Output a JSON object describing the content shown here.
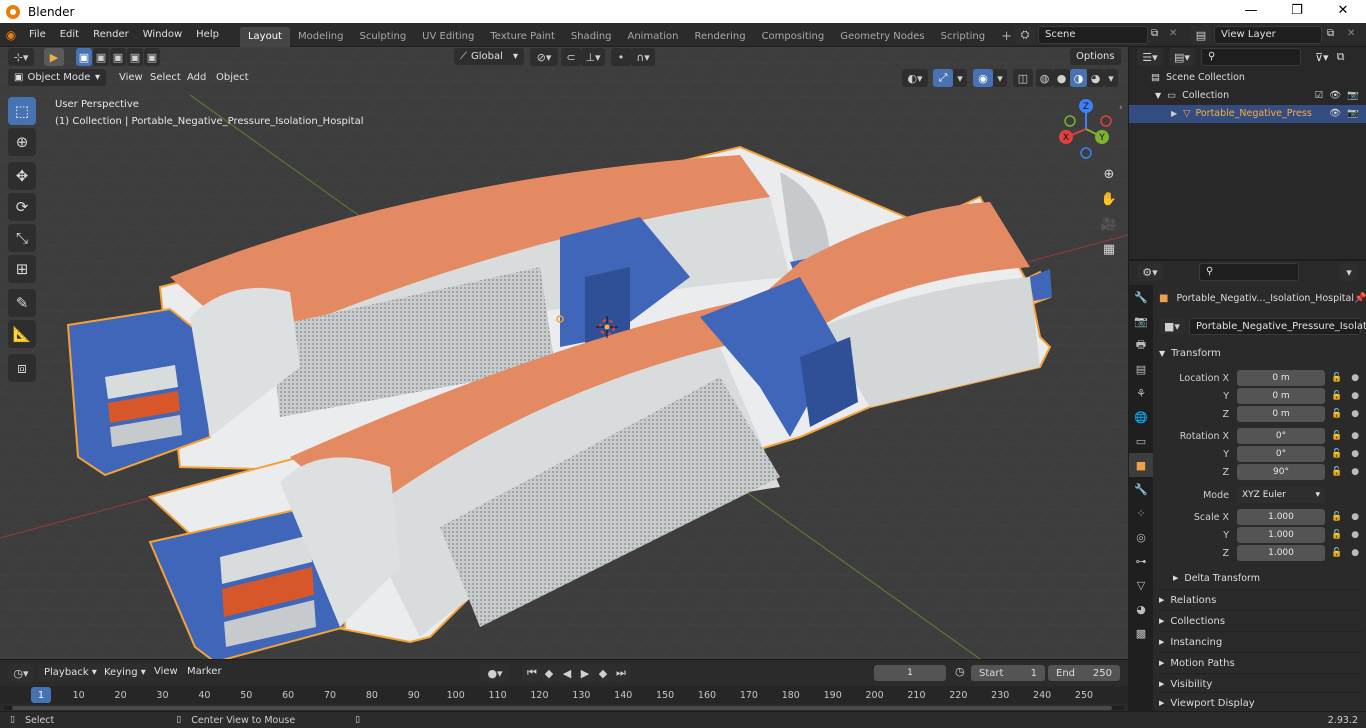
{
  "window": {
    "title": "Blender",
    "minimize": "—",
    "maximize": "❐",
    "close": "✕"
  },
  "menus": [
    "File",
    "Edit",
    "Render",
    "Window",
    "Help"
  ],
  "workspaces": [
    "Layout",
    "Modeling",
    "Sculpting",
    "UV Editing",
    "Texture Paint",
    "Shading",
    "Animation",
    "Rendering",
    "Compositing",
    "Geometry Nodes",
    "Scripting"
  ],
  "active_workspace": "Layout",
  "add_workspace": "+",
  "scene": {
    "name": "Scene"
  },
  "view_layer": {
    "name": "View Layer"
  },
  "viewport": {
    "mode": "Object Mode",
    "menu": [
      "View",
      "Select",
      "Add",
      "Object"
    ],
    "transform_orientation": "Global",
    "options": "Options",
    "perspective": "User Perspective",
    "collection_info": "(1) Collection | Portable_Negative_Pressure_Isolation_Hospital",
    "gizmo": {
      "x": "X",
      "y": "Y",
      "z": "Z"
    }
  },
  "outliner": {
    "root": "Scene Collection",
    "collection": "Collection",
    "object": "Portable_Negative_Press"
  },
  "properties": {
    "object_name_short": "Portable_Negativ..._Isolation_Hospital",
    "object_name": "Portable_Negative_Pressure_Isolation_H...",
    "transform_title": "Transform",
    "location_label": "Location X",
    "rotation_label": "Rotation X",
    "scale_label": "Scale X",
    "y_label": "Y",
    "z_label": "Z",
    "location": [
      "0 m",
      "0 m",
      "0 m"
    ],
    "rotation": [
      "0°",
      "0°",
      "90°"
    ],
    "mode_label": "Mode",
    "rotation_mode": "XYZ Euler",
    "scale": [
      "1.000",
      "1.000",
      "1.000"
    ],
    "delta_transform": "Delta Transform",
    "sections": [
      "Relations",
      "Collections",
      "Instancing",
      "Motion Paths",
      "Visibility",
      "Viewport Display"
    ]
  },
  "timeline": {
    "menu": [
      "Playback",
      "Keying",
      "View",
      "Marker"
    ],
    "current_frame": "1",
    "start_label": "Start",
    "start": "1",
    "end_label": "End",
    "end": "250",
    "ticks": [
      "1",
      "10",
      "20",
      "30",
      "40",
      "50",
      "60",
      "70",
      "80",
      "90",
      "100",
      "110",
      "120",
      "130",
      "140",
      "150",
      "160",
      "170",
      "180",
      "190",
      "200",
      "210",
      "220",
      "230",
      "240",
      "250"
    ]
  },
  "status": {
    "select": "Select",
    "center_view": "Center View to Mouse",
    "version": "2.93.2"
  },
  "colors": {
    "accent": "#4772b3",
    "selection_outline": "#f2a23a",
    "tent_orange": "#e48a63",
    "tent_white": "#d9dcdd",
    "tent_blue": "#3f66b8"
  }
}
